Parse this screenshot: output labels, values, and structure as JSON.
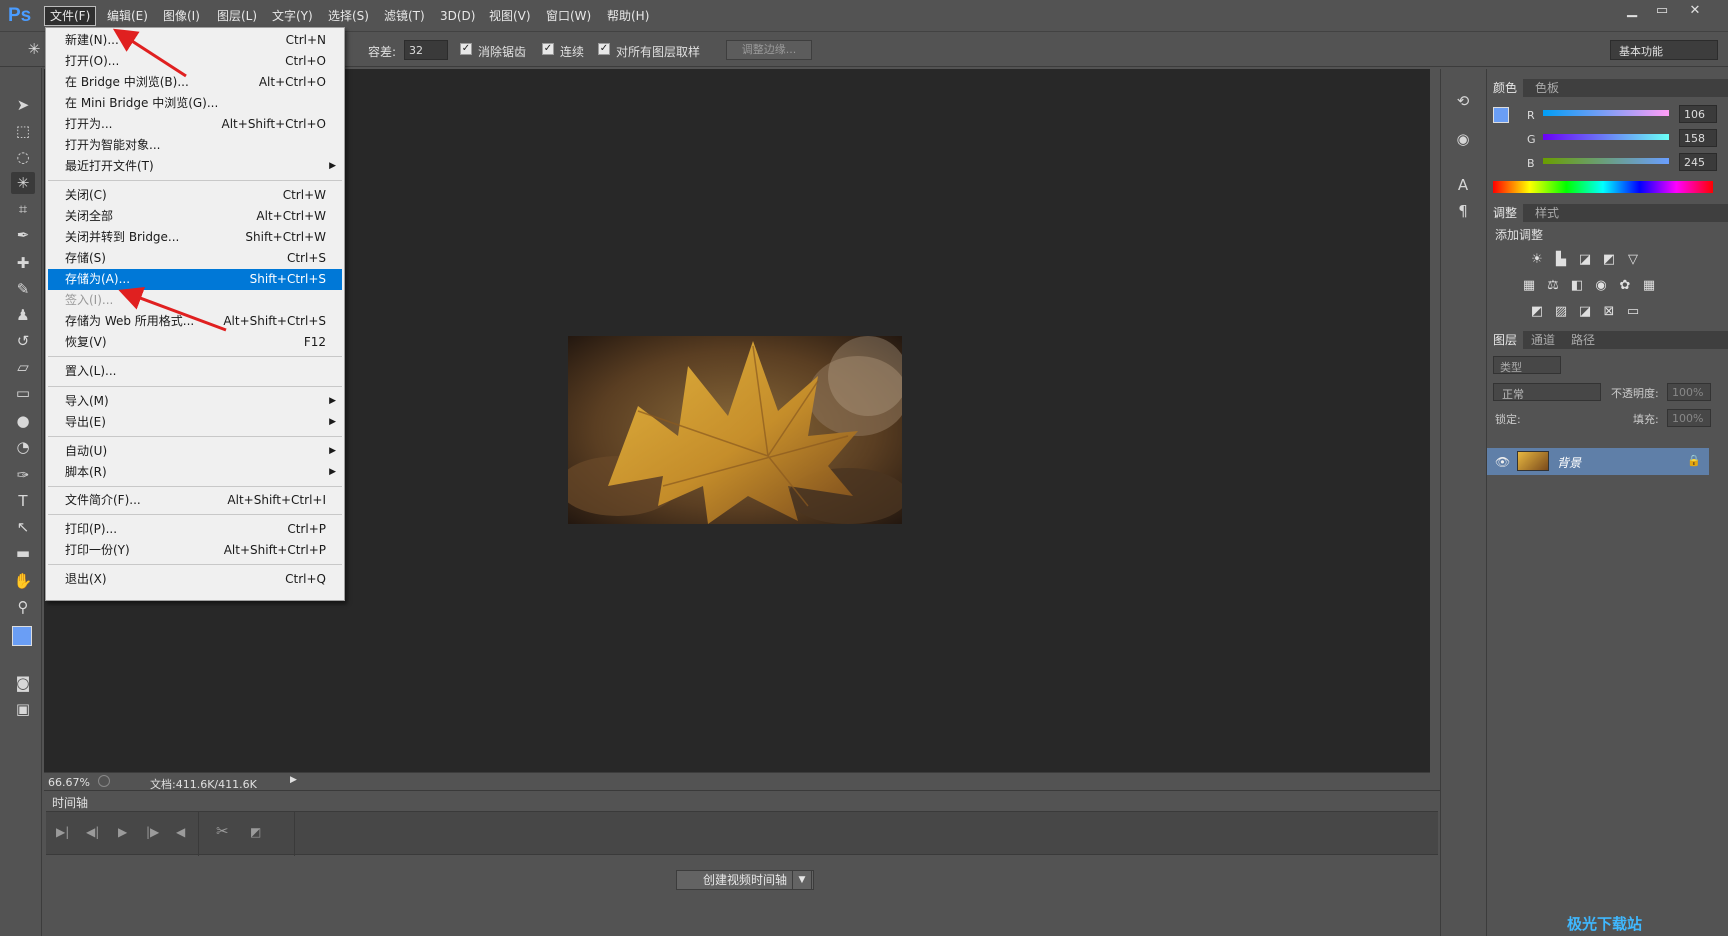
{
  "app": {
    "logo": "Ps",
    "accent": "#0078d7"
  },
  "menubar": {
    "items": [
      "文件(F)",
      "编辑(E)",
      "图像(I)",
      "图层(L)",
      "文字(Y)",
      "选择(S)",
      "滤镜(T)",
      "3D(D)",
      "视图(V)",
      "窗口(W)",
      "帮助(H)"
    ],
    "window_controls": {
      "minimize": "▁",
      "restore": "▭",
      "close": "✕"
    }
  },
  "options_bar": {
    "tolerance_label": "容差:",
    "tolerance_value": "32",
    "anti_alias": "消除锯齿",
    "contiguous": "连续",
    "sample_all": "对所有图层取样",
    "refine_edge": "调整边缘...",
    "workspace": "基本功能"
  },
  "file_menu": {
    "items": [
      {
        "label": "新建(N)...",
        "shortcut": "Ctrl+N"
      },
      {
        "label": "打开(O)...",
        "shortcut": "Ctrl+O"
      },
      {
        "label": "在 Bridge 中浏览(B)...",
        "shortcut": "Alt+Ctrl+O"
      },
      {
        "label": "在 Mini Bridge 中浏览(G)...",
        "shortcut": ""
      },
      {
        "label": "打开为...",
        "shortcut": "Alt+Shift+Ctrl+O"
      },
      {
        "label": "打开为智能对象...",
        "shortcut": ""
      },
      {
        "label": "最近打开文件(T)",
        "shortcut": ""
      },
      {
        "label": "关闭(C)",
        "shortcut": "Ctrl+W"
      },
      {
        "label": "关闭全部",
        "shortcut": "Alt+Ctrl+W"
      },
      {
        "label": "关闭并转到 Bridge...",
        "shortcut": "Shift+Ctrl+W"
      },
      {
        "label": "存储(S)",
        "shortcut": "Ctrl+S"
      },
      {
        "label": "存储为(A)...",
        "shortcut": "Shift+Ctrl+S"
      },
      {
        "label": "签入(I)...",
        "shortcut": ""
      },
      {
        "label": "存储为 Web 所用格式...",
        "shortcut": "Alt+Shift+Ctrl+S"
      },
      {
        "label": "恢复(V)",
        "shortcut": "F12"
      },
      {
        "label": "置入(L)...",
        "shortcut": ""
      },
      {
        "label": "导入(M)",
        "shortcut": ""
      },
      {
        "label": "导出(E)",
        "shortcut": ""
      },
      {
        "label": "自动(U)",
        "shortcut": ""
      },
      {
        "label": "脚本(R)",
        "shortcut": ""
      },
      {
        "label": "文件简介(F)...",
        "shortcut": "Alt+Shift+Ctrl+I"
      },
      {
        "label": "打印(P)...",
        "shortcut": "Ctrl+P"
      },
      {
        "label": "打印一份(Y)",
        "shortcut": "Alt+Shift+Ctrl+P"
      },
      {
        "label": "退出(X)",
        "shortcut": "Ctrl+Q"
      }
    ],
    "submenu_arrow": "▶"
  },
  "status": {
    "zoom": "66.67%",
    "doc": "文档:411.6K/411.6K"
  },
  "timeline": {
    "title": "时间轴",
    "create_button": "创建视频时间轴"
  },
  "color_panel": {
    "tabs": [
      "颜色",
      "色板"
    ],
    "r_label": "R",
    "g_label": "G",
    "b_label": "B",
    "r": "106",
    "g": "158",
    "b": "245",
    "foreground": "#6a9ef5"
  },
  "adjust_panel": {
    "tabs": [
      "调整",
      "样式"
    ],
    "title": "添加调整"
  },
  "layers_panel": {
    "tabs": [
      "图层",
      "通道",
      "路径"
    ],
    "filter": "类型",
    "blend": "正常",
    "opacity_label": "不透明度:",
    "opacity": "100%",
    "lock_label": "锁定:",
    "fill_label": "填充:",
    "fill": "100%",
    "layer_name": "背景"
  },
  "watermark": "极光下载站"
}
